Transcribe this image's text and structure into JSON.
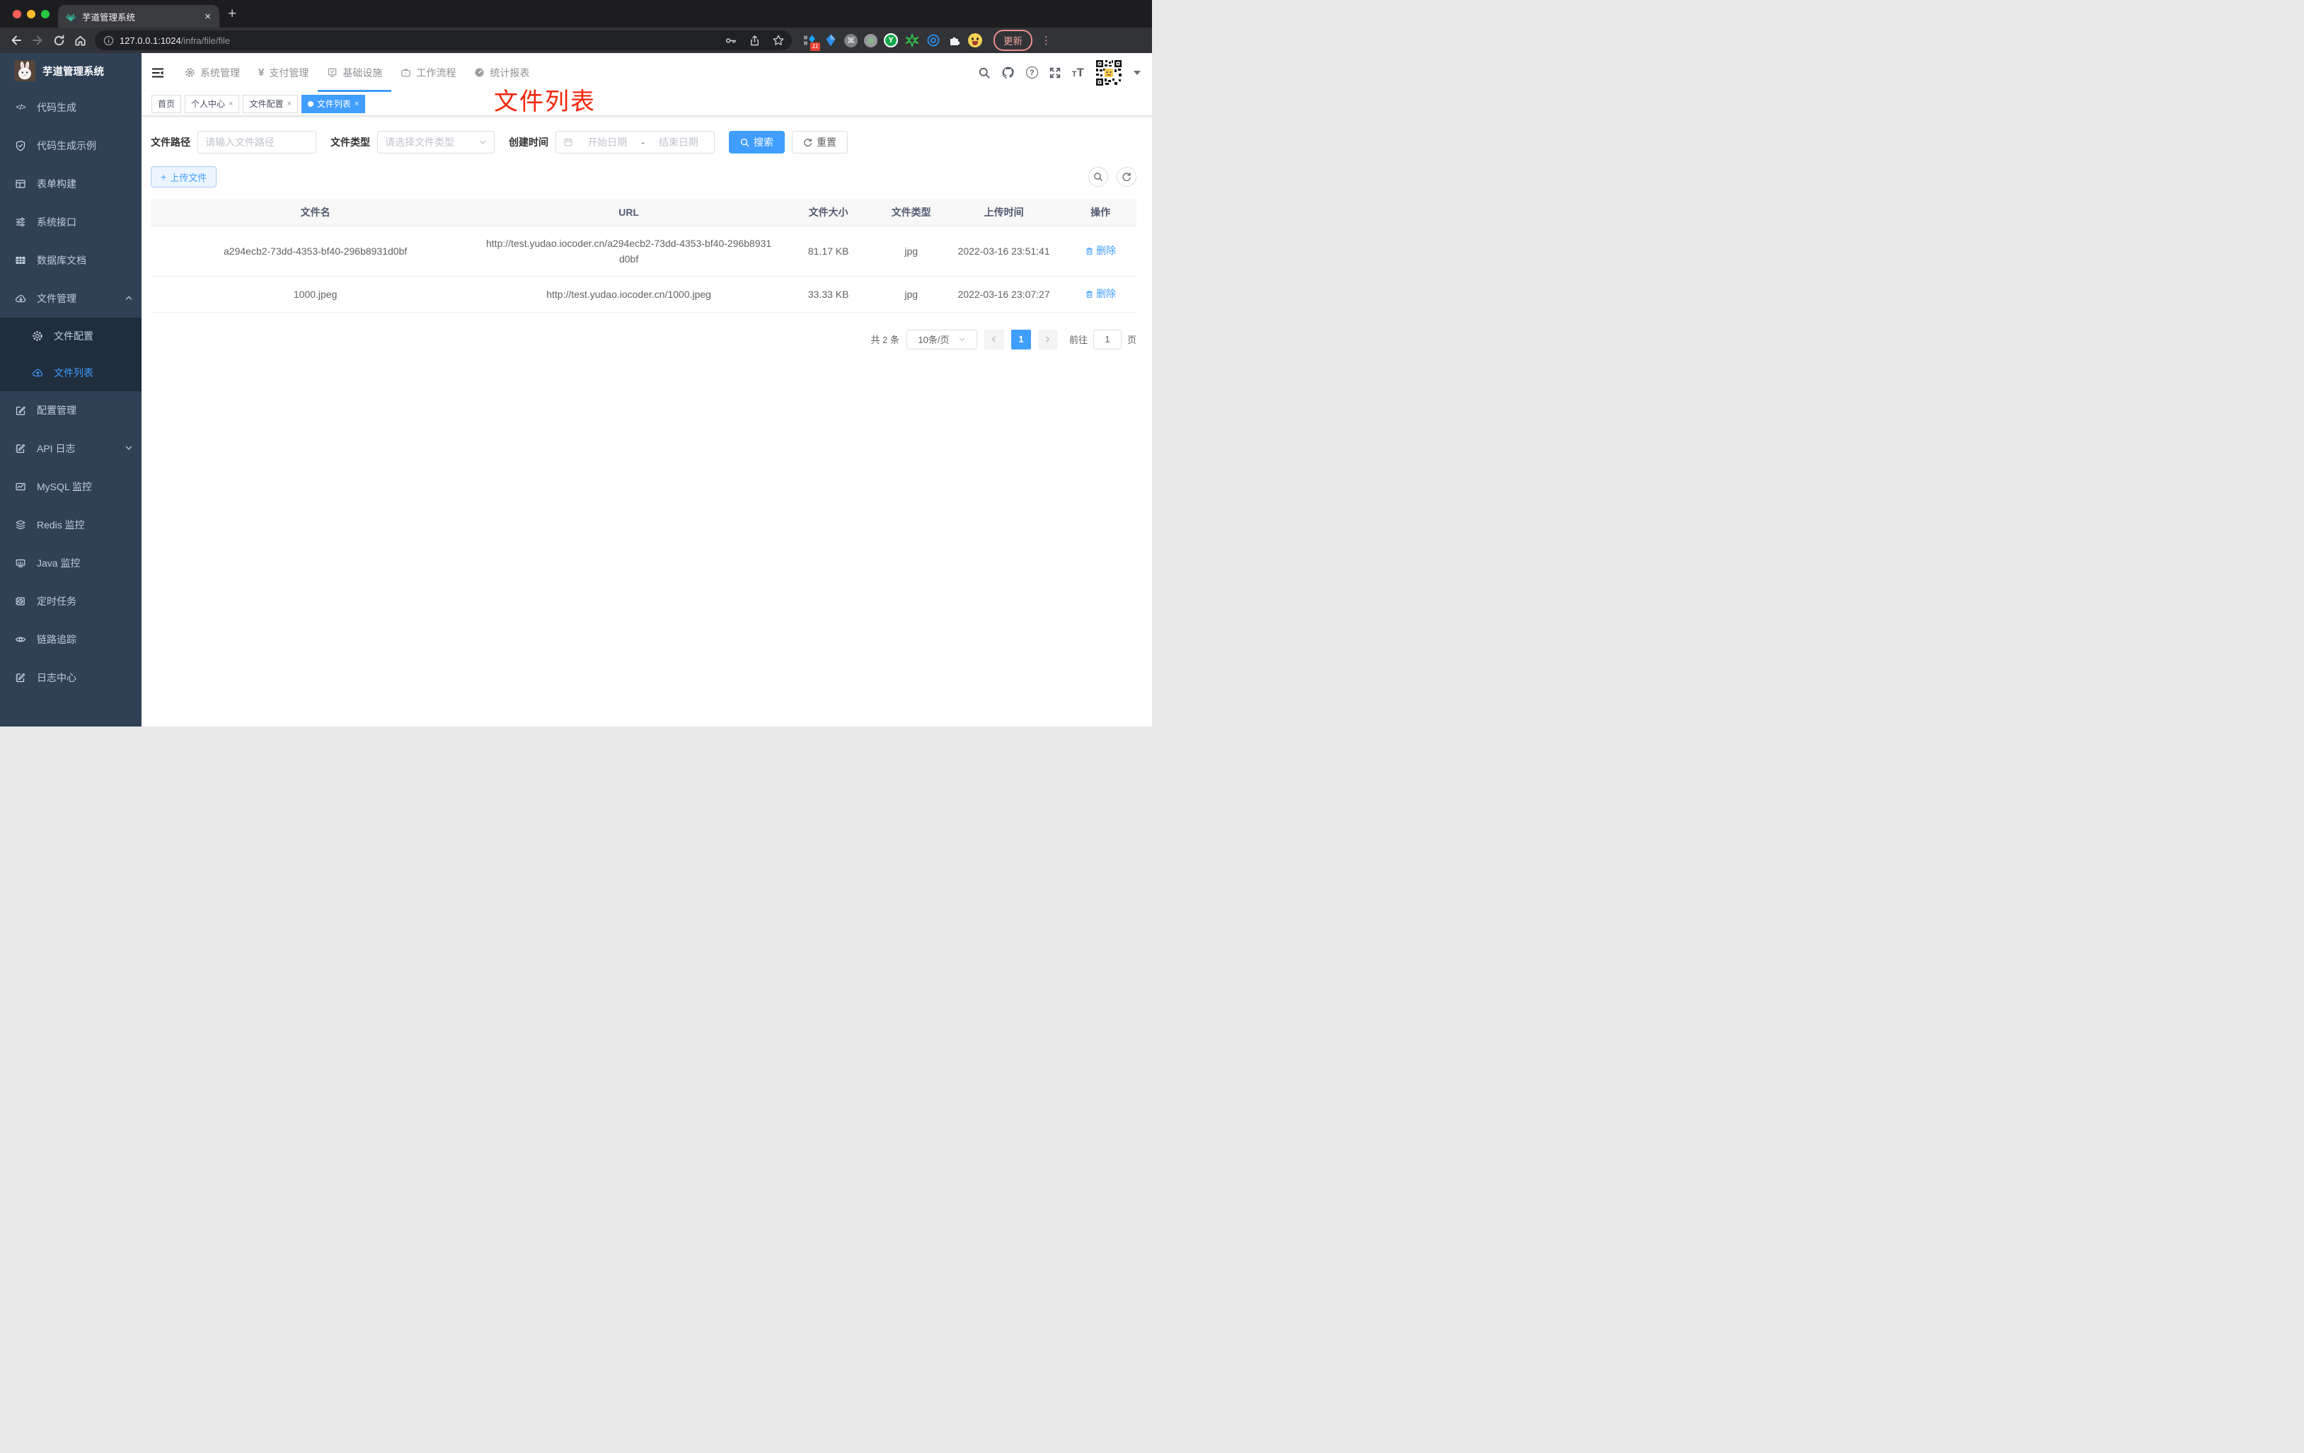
{
  "colors": {
    "accent": "#409eff",
    "annotation_red": "#f3260b",
    "sidebar_bg": "#304156",
    "submenu_bg": "#1f2d3d"
  },
  "browser": {
    "tab_title": "芋道管理系统",
    "url_host": "127.0.0.1:1024",
    "url_path": "/infra/file/file",
    "extensions_badge": "11",
    "update_label": "更新",
    "menu_dots": "⋮"
  },
  "icons": {
    "close": "×",
    "plus": "+",
    "yen": "¥",
    "question": "?",
    "code": "</>",
    "cmd": "⌘",
    "y_letter": "Y",
    "t_small": "T",
    "t_large": "T"
  },
  "sidebar": {
    "logo_title": "芋道管理系统",
    "items_top": [
      {
        "label": "代码生成"
      },
      {
        "label": "代码生成示例"
      },
      {
        "label": "表单构建"
      },
      {
        "label": "系统接口"
      },
      {
        "label": "数据库文档"
      },
      {
        "label": "文件管理"
      }
    ],
    "submenu": [
      {
        "label": "文件配置"
      },
      {
        "label": "文件列表"
      }
    ],
    "items_bottom": [
      {
        "label": "配置管理"
      },
      {
        "label": "API 日志"
      },
      {
        "label": "MySQL 监控"
      },
      {
        "label": "Redis 监控"
      },
      {
        "label": "Java 监控"
      },
      {
        "label": "定时任务"
      },
      {
        "label": "链路追踪"
      },
      {
        "label": "日志中心"
      }
    ]
  },
  "navbar": {
    "menus": [
      {
        "label": "系统管理"
      },
      {
        "label": "支付管理"
      },
      {
        "label": "基础设施"
      },
      {
        "label": "工作流程"
      },
      {
        "label": "统计报表"
      }
    ]
  },
  "tags": [
    {
      "label": "首页"
    },
    {
      "label": "个人中心"
    },
    {
      "label": "文件配置"
    },
    {
      "label": "文件列表"
    }
  ],
  "annotation": {
    "text": "文件列表"
  },
  "filter": {
    "path_label": "文件路径",
    "path_placeholder": "请输入文件路径",
    "type_label": "文件类型",
    "type_placeholder": "请选择文件类型",
    "date_label": "创建时间",
    "date_start": "开始日期",
    "date_sep": "-",
    "date_end": "结束日期",
    "search": "搜索",
    "reset": "重置"
  },
  "toolbar": {
    "upload": "上传文件"
  },
  "table": {
    "columns": [
      "文件名",
      "URL",
      "文件大小",
      "文件类型",
      "上传时间",
      "操作"
    ],
    "rows": [
      {
        "name": "a294ecb2-73dd-4353-bf40-296b8931d0bf",
        "url": "http://test.yudao.iocoder.cn/a294ecb2-73dd-4353-bf40-296b8931d0bf",
        "size": "81.17 KB",
        "type": "jpg",
        "time": "2022-03-16 23:51:41",
        "action": "删除"
      },
      {
        "name": "1000.jpeg",
        "url": "http://test.yudao.iocoder.cn/1000.jpeg",
        "size": "33.33 KB",
        "type": "jpg",
        "time": "2022-03-16 23:07:27",
        "action": "删除"
      }
    ]
  },
  "pagination": {
    "total": "共 2 条",
    "size": "10条/页",
    "page": "1",
    "goto": "前往",
    "goto_value": "1",
    "unit": "页"
  }
}
